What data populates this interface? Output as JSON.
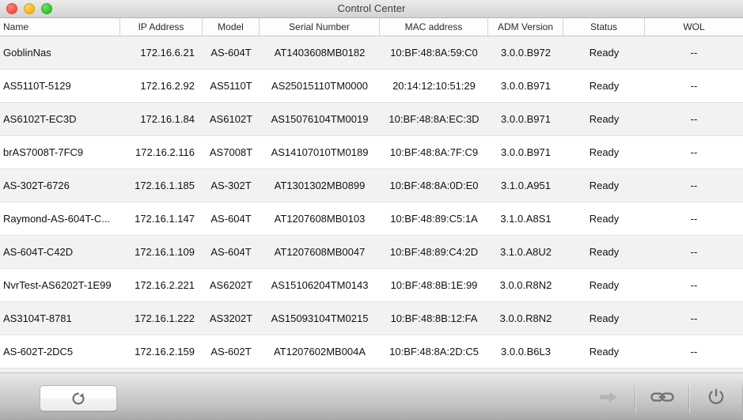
{
  "window": {
    "title": "Control Center",
    "traffic_lights": [
      {
        "name": "close",
        "color": "#f4564b"
      },
      {
        "name": "minimize",
        "color": "#f9b825"
      },
      {
        "name": "zoom",
        "color": "#35c92f"
      }
    ]
  },
  "table": {
    "columns": [
      {
        "key": "name",
        "label": "Name"
      },
      {
        "key": "ip",
        "label": "IP Address"
      },
      {
        "key": "model",
        "label": "Model"
      },
      {
        "key": "serial",
        "label": "Serial Number"
      },
      {
        "key": "mac",
        "label": "MAC address"
      },
      {
        "key": "adm",
        "label": "ADM Version"
      },
      {
        "key": "status",
        "label": "Status"
      },
      {
        "key": "wol",
        "label": "WOL"
      }
    ],
    "rows": [
      {
        "name": "GoblinNas",
        "ip": "172.16.6.21",
        "model": "AS-604T",
        "serial": "AT1403608MB0182",
        "mac": "10:BF:48:8A:59:C0",
        "adm": "3.0.0.B972",
        "status": "Ready",
        "wol": "--"
      },
      {
        "name": "AS5110T-5129",
        "ip": "172.16.2.92",
        "model": "AS5110T",
        "serial": "AS25015110TM0000",
        "mac": "20:14:12:10:51:29",
        "adm": "3.0.0.B971",
        "status": "Ready",
        "wol": "--"
      },
      {
        "name": "AS6102T-EC3D",
        "ip": "172.16.1.84",
        "model": "AS6102T",
        "serial": "AS15076104TM0019",
        "mac": "10:BF:48:8A:EC:3D",
        "adm": "3.0.0.B971",
        "status": "Ready",
        "wol": "--"
      },
      {
        "name": "brAS7008T-7FC9",
        "ip": "172.16.2.116",
        "model": "AS7008T",
        "serial": "AS14107010TM0189",
        "mac": "10:BF:48:8A:7F:C9",
        "adm": "3.0.0.B971",
        "status": "Ready",
        "wol": "--"
      },
      {
        "name": "AS-302T-6726",
        "ip": "172.16.1.185",
        "model": "AS-302T",
        "serial": "AT1301302MB0899",
        "mac": "10:BF:48:8A:0D:E0",
        "adm": "3.1.0.A951",
        "status": "Ready",
        "wol": "--"
      },
      {
        "name": "Raymond-AS-604T-C...",
        "ip": "172.16.1.147",
        "model": "AS-604T",
        "serial": "AT1207608MB0103",
        "mac": "10:BF:48:89:C5:1A",
        "adm": "3.1.0.A8S1",
        "status": "Ready",
        "wol": "--"
      },
      {
        "name": "AS-604T-C42D",
        "ip": "172.16.1.109",
        "model": "AS-604T",
        "serial": "AT1207608MB0047",
        "mac": "10:BF:48:89:C4:2D",
        "adm": "3.1.0.A8U2",
        "status": "Ready",
        "wol": "--"
      },
      {
        "name": "NvrTest-AS6202T-1E99",
        "ip": "172.16.2.221",
        "model": "AS6202T",
        "serial": "AS15106204TM0143",
        "mac": "10:BF:48:8B:1E:99",
        "adm": "3.0.0.R8N2",
        "status": "Ready",
        "wol": "--"
      },
      {
        "name": "AS3104T-8781",
        "ip": "172.16.1.222",
        "model": "AS3202T",
        "serial": "AS15093104TM0215",
        "mac": "10:BF:48:8B:12:FA",
        "adm": "3.0.0.R8N2",
        "status": "Ready",
        "wol": "--"
      },
      {
        "name": "AS-602T-2DC5",
        "ip": "172.16.2.159",
        "model": "AS-602T",
        "serial": "AT1207602MB004A",
        "mac": "10:BF:48:8A:2D:C5",
        "adm": "3.0.0.B6L3",
        "status": "Ready",
        "wol": "--"
      }
    ]
  },
  "footer": {
    "refresh": {
      "icon": "refresh-icon"
    },
    "tools": [
      {
        "icon": "arrow-right-icon",
        "enabled": false
      },
      {
        "icon": "link-icon",
        "enabled": true
      },
      {
        "icon": "power-icon",
        "enabled": true
      }
    ]
  }
}
